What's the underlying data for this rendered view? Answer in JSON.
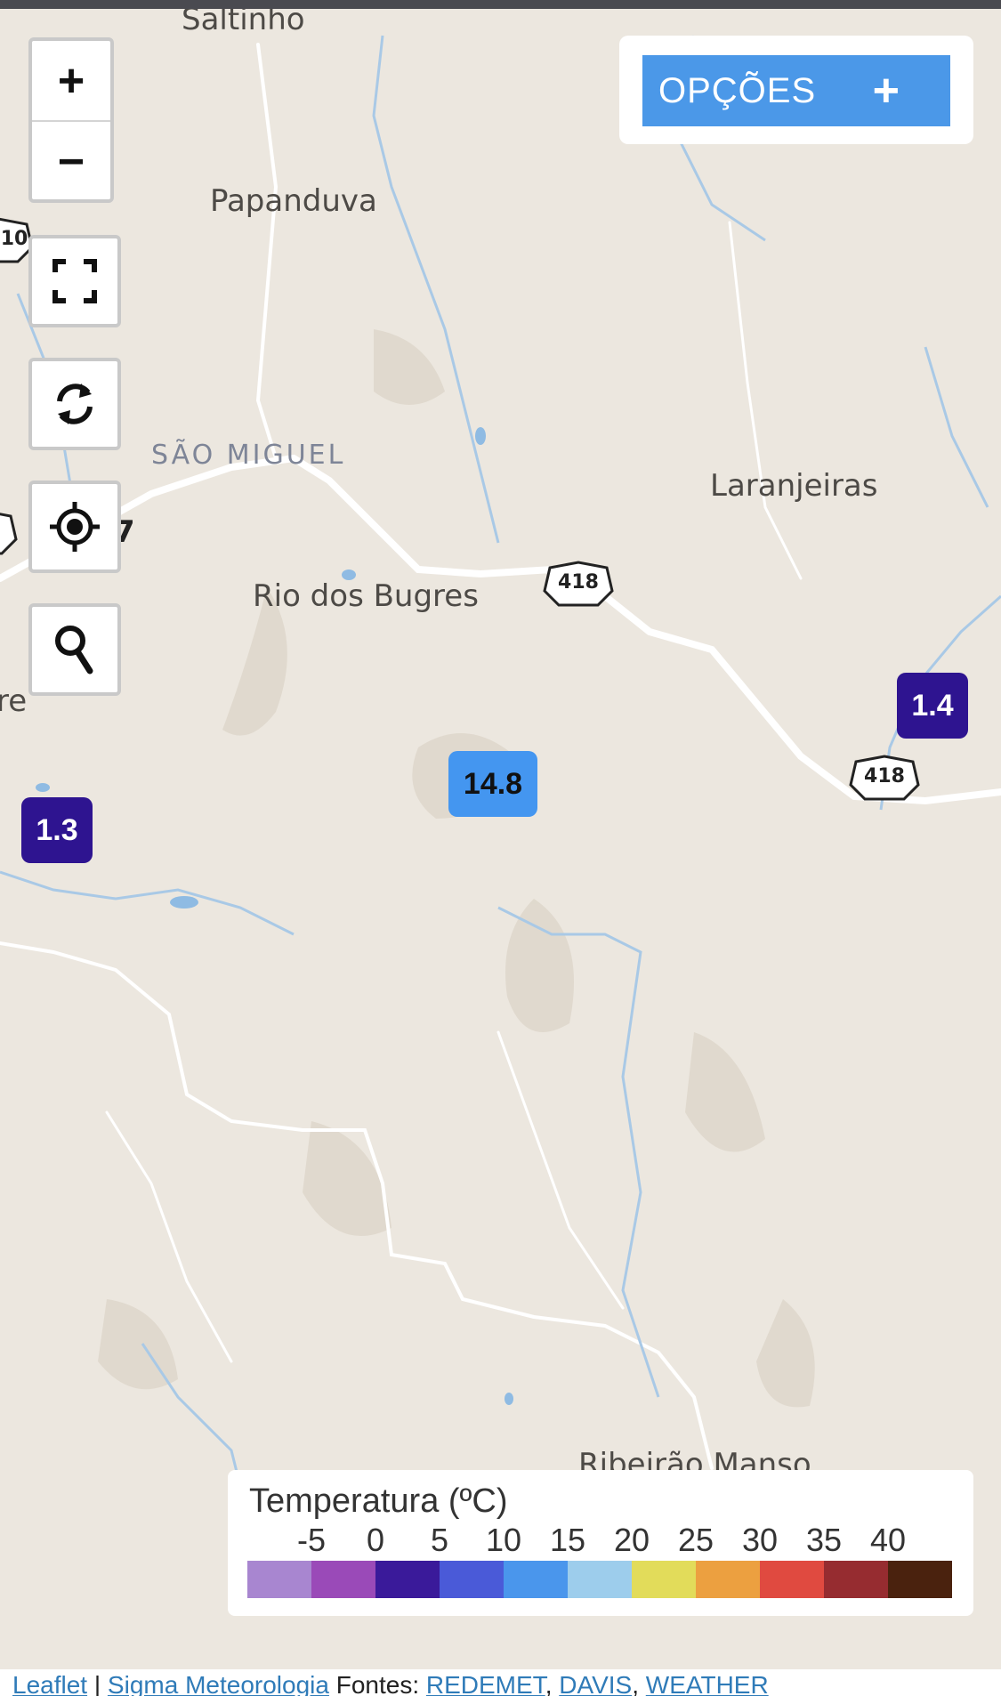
{
  "map": {
    "places": {
      "saltinho": "Saltinho",
      "papanduva": "Papanduva",
      "sao_miguel": "SÃO MIGUEL",
      "laranjeiras": "Laranjeiras",
      "rio_dos_bugres": "Rio dos Bugres",
      "ribeirao_manso": "Ribeirão Manso",
      "edge_re": "re"
    },
    "road_shields": {
      "a": "418",
      "b": "418",
      "left_top": "10",
      "left_mid": "7"
    }
  },
  "controls": {
    "zoom_in": "+",
    "zoom_out": "−",
    "fullscreen_icon": "fullscreen-icon",
    "refresh_icon": "refresh-icon",
    "locate_icon": "locate-icon",
    "search_icon": "search-icon"
  },
  "options": {
    "label": "OPÇÕES",
    "plus": "+"
  },
  "markers": [
    {
      "value": "14.8",
      "color": "#4496f0",
      "text_color": "#111111"
    },
    {
      "value": "1.4",
      "color": "#2e1490",
      "text_color": "#ffffff"
    },
    {
      "value": "1.3",
      "color": "#2e1490",
      "text_color": "#ffffff"
    }
  ],
  "legend": {
    "title": "Temperatura (ºC)",
    "ticks": [
      "-5",
      "0",
      "5",
      "10",
      "15",
      "20",
      "25",
      "30",
      "35",
      "40"
    ],
    "colors": [
      "#a886d0",
      "#9a4ab8",
      "#3a1a9a",
      "#4a5ad8",
      "#4a96ec",
      "#9dcdec",
      "#e2dc5a",
      "#eca040",
      "#e04a40",
      "#962c30",
      "#4a220e"
    ]
  },
  "attribution": {
    "leaflet": "Leaflet",
    "sep": " | ",
    "sigma": "Sigma Meteorologia",
    "fontes": " Fontes: ",
    "redemet": "REDEMET",
    "comma1": ", ",
    "davis": "DAVIS",
    "comma2": ", ",
    "weather": "WEATHER"
  }
}
